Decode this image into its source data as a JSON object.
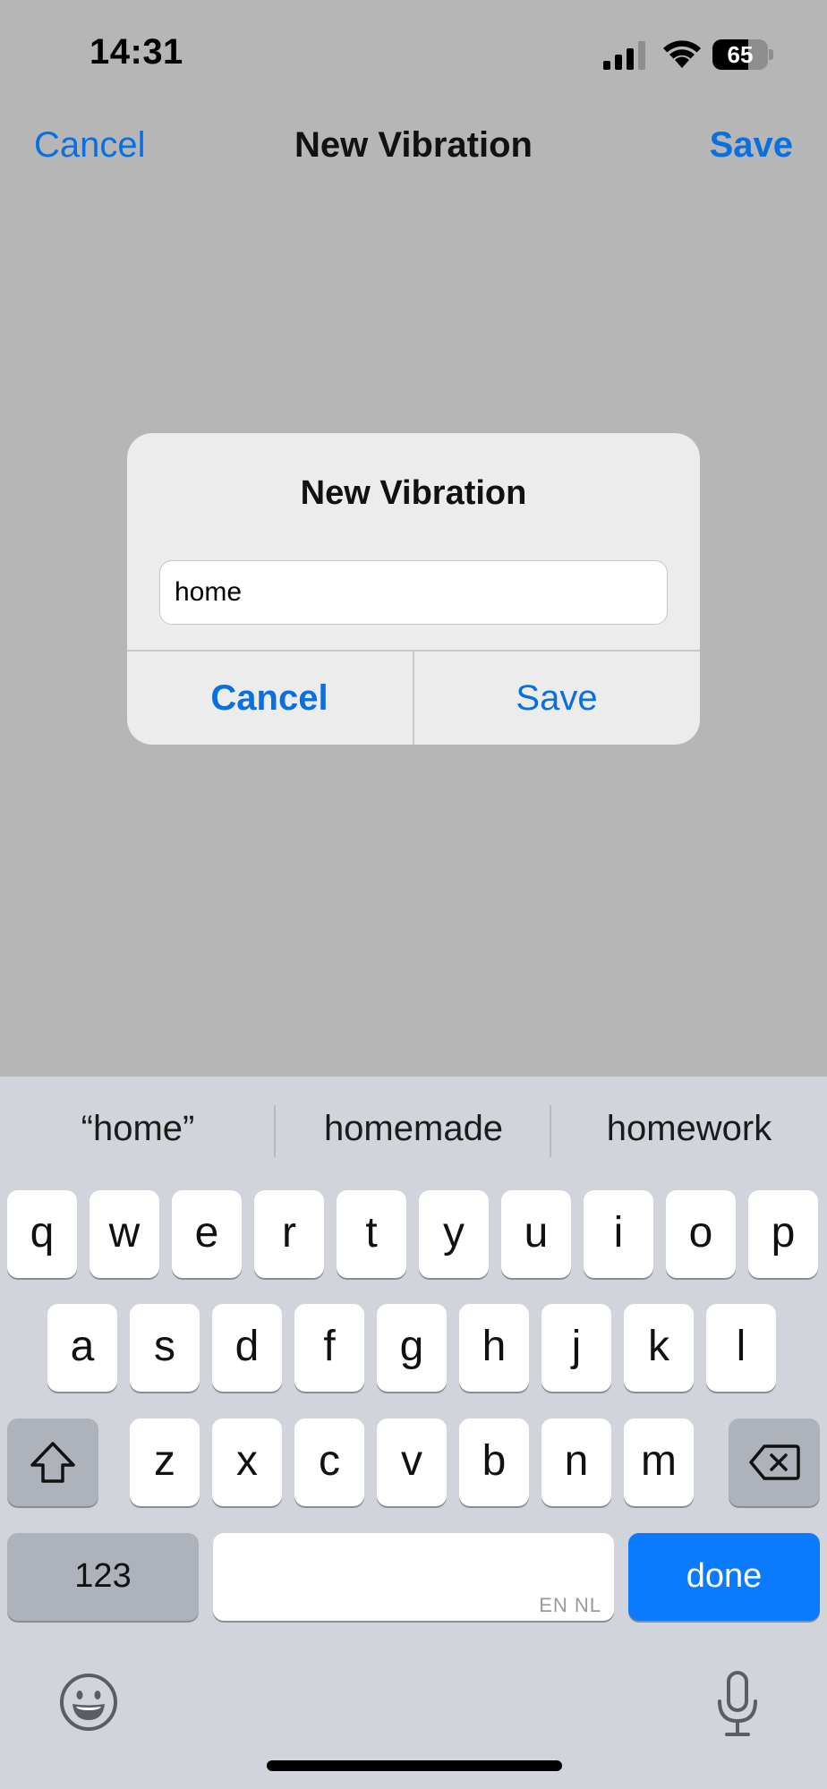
{
  "status_bar": {
    "time": "14:31",
    "battery_level": "65",
    "battery_percent": 65,
    "icons": [
      "signal-icon",
      "wifi-icon",
      "battery-icon"
    ]
  },
  "nav": {
    "cancel_label": "Cancel",
    "title": "New Vibration",
    "save_label": "Save"
  },
  "alert": {
    "title": "New Vibration",
    "input_value": "home",
    "cancel_label": "Cancel",
    "save_label": "Save"
  },
  "keyboard": {
    "suggestions": [
      "“home”",
      "homemade",
      "homework"
    ],
    "row1": [
      "q",
      "w",
      "e",
      "r",
      "t",
      "y",
      "u",
      "i",
      "o",
      "p"
    ],
    "row2": [
      "a",
      "s",
      "d",
      "f",
      "g",
      "h",
      "j",
      "k",
      "l"
    ],
    "row3": [
      "z",
      "x",
      "c",
      "v",
      "b",
      "n",
      "m"
    ],
    "numbers_label": "123",
    "space_languages": "EN NL",
    "done_label": "done",
    "icons": [
      "shift-icon",
      "delete-icon",
      "emoji-icon",
      "microphone-icon"
    ]
  },
  "colors": {
    "accent": "#0a70e0",
    "done_key": "#0a7aff",
    "dimmed_background": "#b6b6b6",
    "keyboard_background": "#d1d4da"
  }
}
